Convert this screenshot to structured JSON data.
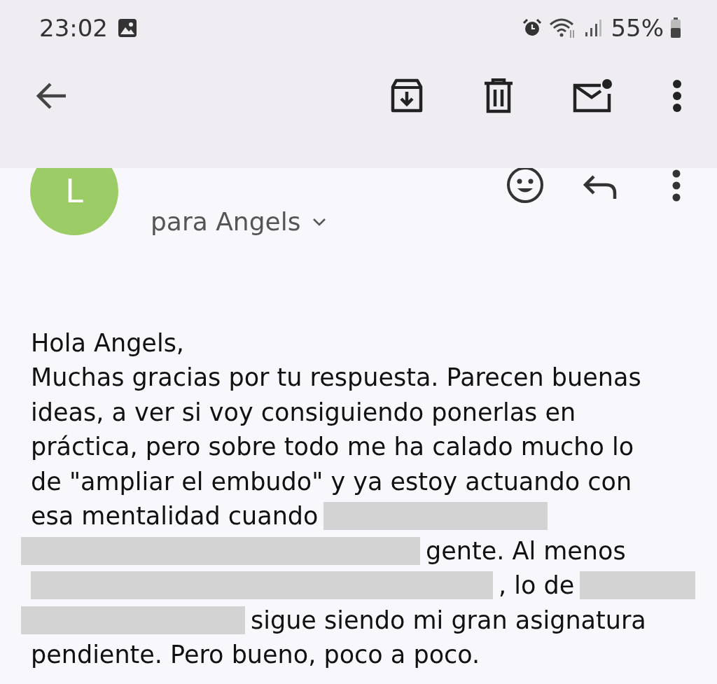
{
  "status_bar": {
    "time": "23:02",
    "battery": "55%"
  },
  "toolbar": {
    "actions": [
      {
        "kind": "back"
      },
      {
        "kind": "archive"
      },
      {
        "kind": "delete"
      },
      {
        "kind": "mark_unread"
      },
      {
        "kind": "more"
      }
    ]
  },
  "message": {
    "avatar_letter": "L",
    "recipients": "para Angels",
    "body": [
      [
        {
          "kind": "text",
          "text": "Hola Angels,"
        }
      ],
      [
        {
          "kind": "text",
          "text": "Muchas gracias por tu respuesta. Parecen buenas"
        }
      ],
      [
        {
          "kind": "text",
          "text": "ideas, a ver si voy consiguiendo ponerlas en"
        }
      ],
      [
        {
          "kind": "text",
          "text": "práctica, pero sobre todo me ha calado mucho lo"
        }
      ],
      [
        {
          "kind": "text",
          "text": "de \"ampliar el embudo\" y ya estoy actuando con"
        }
      ],
      [
        {
          "kind": "text",
          "text": "esa mentalidad cuando"
        },
        {
          "kind": "redaction"
        }
      ],
      [
        {
          "kind": "redaction"
        },
        {
          "kind": "text",
          "text": "gente. Al menos"
        }
      ],
      [
        {
          "kind": "redaction"
        },
        {
          "kind": "text",
          "text": ", lo de"
        },
        {
          "kind": "redaction"
        }
      ],
      [
        {
          "kind": "redaction"
        },
        {
          "kind": "text",
          "text": "sigue siendo mi gran asignatura"
        }
      ],
      [
        {
          "kind": "text",
          "text": "pendiente. Pero bueno, poco a poco."
        }
      ]
    ]
  }
}
